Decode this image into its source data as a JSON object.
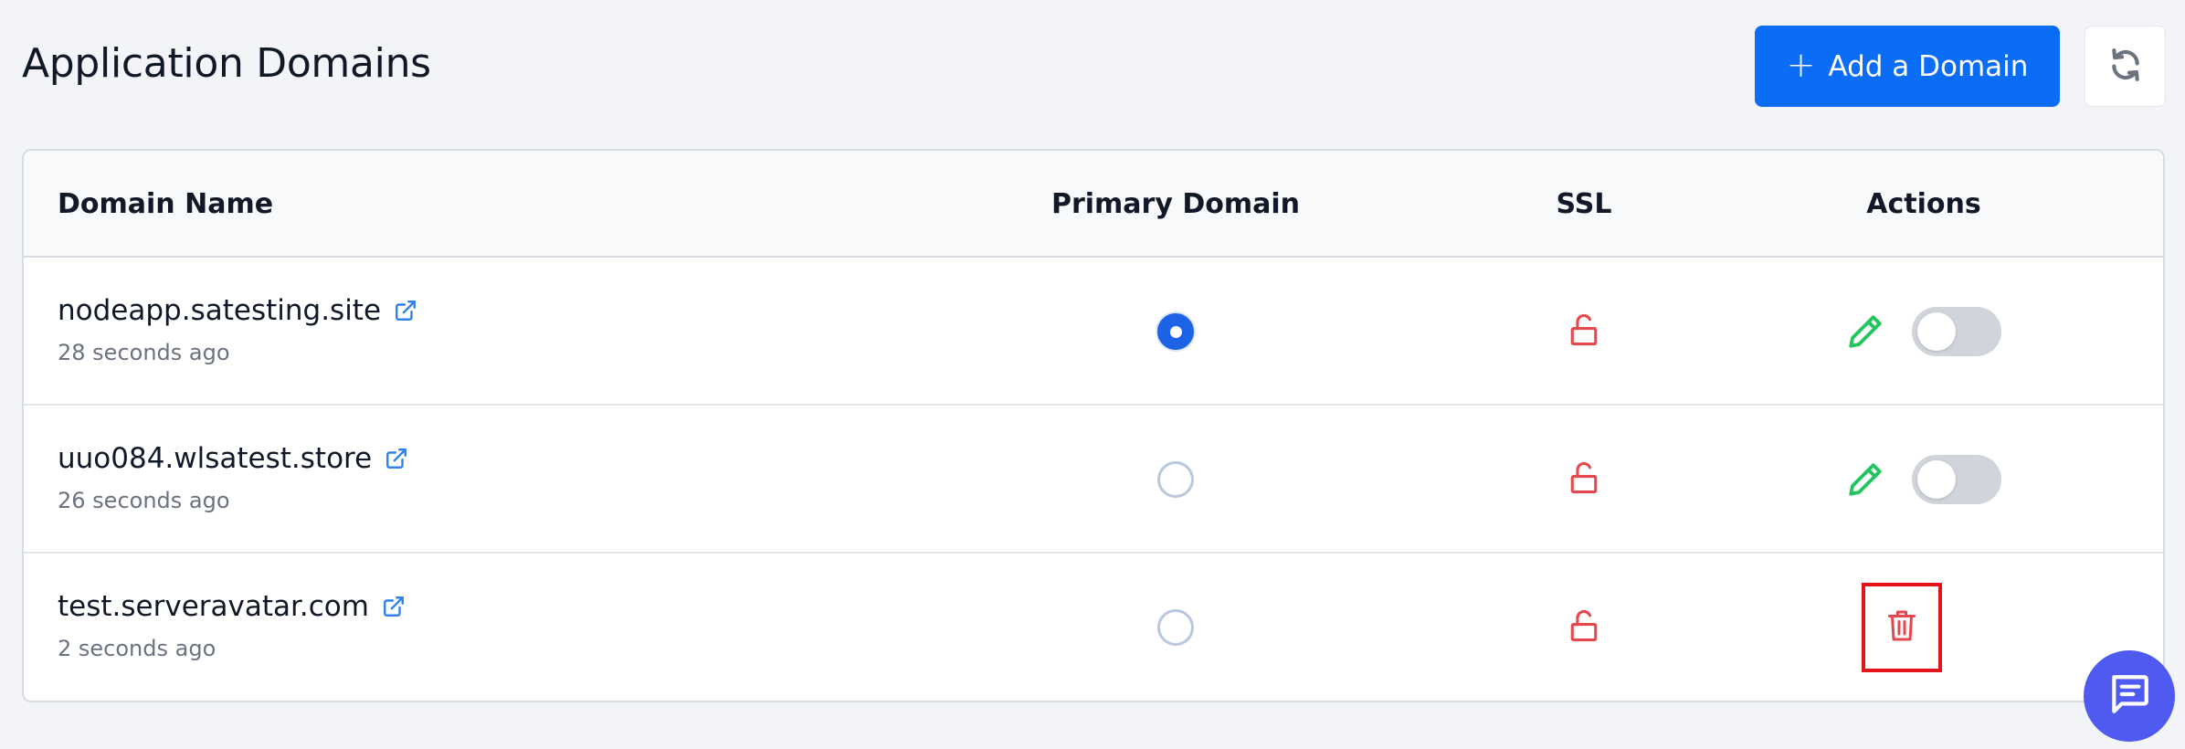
{
  "header": {
    "title": "Application Domains",
    "add_button_label": "Add a Domain",
    "add_icon": "plus-icon",
    "refresh_icon": "refresh-icon"
  },
  "table": {
    "columns": {
      "domain_name": "Domain Name",
      "primary_domain": "Primary Domain",
      "ssl": "SSL",
      "actions": "Actions"
    },
    "rows": [
      {
        "domain": "nodeapp.satesting.site",
        "time": "28 seconds ago",
        "primary": true,
        "ssl_icon": "unlocked-padlock-icon",
        "ssl_enabled": false,
        "actions": [
          "edit",
          "toggle"
        ],
        "toggle_on": false
      },
      {
        "domain": "uuo084.wlsatest.store",
        "time": "26 seconds ago",
        "primary": false,
        "ssl_icon": "unlocked-padlock-icon",
        "ssl_enabled": false,
        "actions": [
          "edit",
          "toggle"
        ],
        "toggle_on": false
      },
      {
        "domain": "test.serveravatar.com",
        "time": "2 seconds ago",
        "primary": false,
        "ssl_icon": "unlocked-padlock-icon",
        "ssl_enabled": false,
        "actions": [
          "delete"
        ],
        "delete_highlighted": true
      }
    ]
  },
  "chat_icon": "chat-bubble-icon",
  "colors": {
    "accent": "#0b6cf5",
    "ssl_off": "#e5484d",
    "edit": "#22c55e",
    "delete": "#e4141b",
    "chat": "#4f5bf0"
  }
}
